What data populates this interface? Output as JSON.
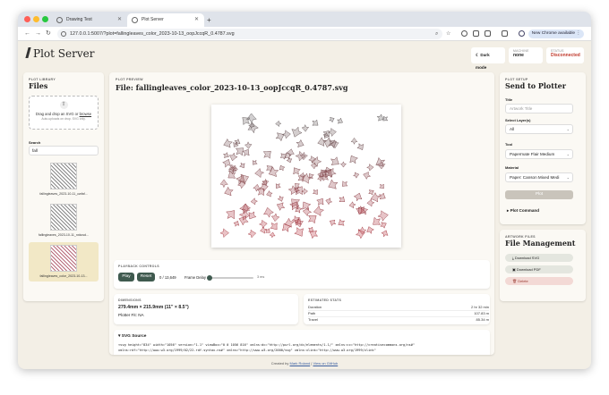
{
  "browser": {
    "tabs": [
      {
        "label": "Drawing Test"
      },
      {
        "label": "Plot Server"
      }
    ],
    "url": "127.0.0.1:5007/?plot=fallingleaves_color_2023-10-13_oopJccqR_0.4787.svg",
    "chrome_button": "New Chrome available"
  },
  "header": {
    "app_title": "Plot Server",
    "dark_mode_label": "Dark mode",
    "machine_label": "MACHINE",
    "machine_value": "none",
    "status_label": "STATUS",
    "status_value": "Disconnected",
    "status_color": "#c0392b"
  },
  "library": {
    "tag": "PLOT LIBRARY",
    "title": "Files",
    "drop_text": "Drag and drop an SVG or",
    "drop_link": "browse",
    "drop_hint": "Auto-uploads on drop. SVG only.",
    "search_label": "Search",
    "search_value": "fall",
    "files": [
      {
        "name": "fallingleaves_2023-10-11_cwfaf...",
        "selected": false
      },
      {
        "name": "fallingleaves_2023-10-11_nxkcsd...",
        "selected": false
      },
      {
        "name": "fallingleaves_color_2023-10-13...",
        "selected": true
      }
    ]
  },
  "preview": {
    "tag": "PLOT PREVIEW",
    "title": "File: fallingleaves_color_2023-10-13_oopJccqR_0.4787.svg",
    "playback_tag": "PLAYBACK CONTROLS",
    "play_label": "Play",
    "reset_label": "Reset",
    "counter": "0 / 13,649",
    "frame_delay_label": "Frame Delay",
    "frame_delay_value": "3 ms",
    "frame_delay_position": 0.0,
    "dimensions_tag": "DIMENSIONS",
    "dimensions_value": "279.4mm × 215.9mm (11\" × 8.5\")",
    "plotter_fit": "Plotter Fit: NA",
    "stats_tag": "ESTIMATED STATS",
    "stats": [
      {
        "label": "Duration",
        "value": "2 hr 32 min"
      },
      {
        "label": "Path",
        "value": "107.83 m"
      },
      {
        "label": "Travel",
        "value": "85.34 m"
      }
    ],
    "source_title": "▾ SVG Source",
    "source_lines": [
      "<svg height=\"834\" width=\"1056\" version=\"1.1\" viewBox=\"0 0 1056 816\" xmlns:dc=\"http://purl.org/dc/elements/1.1/\" xmlns:cc=\"http://creativecommons.org/ns#\"",
      "xmlns:rdf=\"http://www.w3.org/1999/02/22-rdf-syntax-ns#\" xmlns=\"http://www.w3.org/2000/svg\" xmlns:xlink=\"http://www.w3.org/1999/xlink\""
    ]
  },
  "setup": {
    "tag": "PLOT SETUP",
    "title": "Send to Plotter",
    "title_label": "Title",
    "title_placeholder": "Artwork Title",
    "layers_label": "Select Layer(s)",
    "layers_value": "All",
    "tool_label": "Tool",
    "tool_value": "Papermate Flair Medium",
    "material_label": "Material",
    "material_value": "Paper: Canson Mixed Medi",
    "plot_button": "Plot",
    "plot_command": "▸ Plot Command"
  },
  "management": {
    "tag": "ARTWORK FILES",
    "title": "File Management",
    "download_svg": "Download SVG",
    "download_pdf": "Download PDF",
    "delete": "Delete"
  },
  "footer": {
    "created_by": "Created by",
    "author": "Mark Roland",
    "separator": "|",
    "github": "View on GitHub"
  }
}
